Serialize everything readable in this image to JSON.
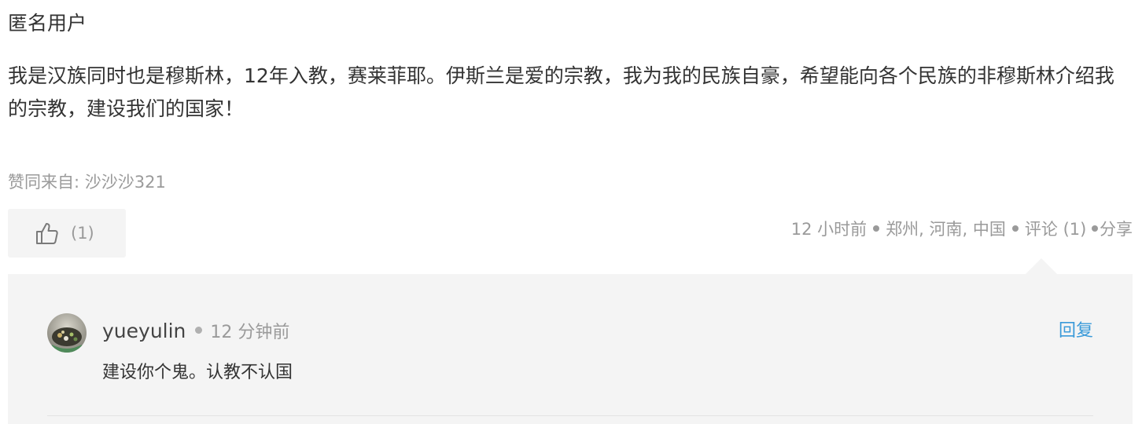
{
  "post": {
    "author": "匿名用户",
    "content": "我是汉族同时也是穆斯林，12年入教，赛莱菲耶。伊斯兰是爱的宗教，我为我的民族自豪，希望能向各个民族的非穆斯林介绍我的宗教，建设我们的国家！",
    "endorsed_by": "赞同来自: 沙沙沙321",
    "like_icon": "thumbs-up-icon",
    "like_count": "(1)",
    "meta": {
      "time": "12 小时前",
      "location": "郑州, 河南, 中国",
      "comments_label": "评论 (1)",
      "share_label": "分享"
    }
  },
  "comments": [
    {
      "user": "yueyulin",
      "time": "12 分钟前",
      "text": "建设你个鬼。认教不认国",
      "reply_label": "回复"
    }
  ],
  "colors": {
    "muted": "#9a9a9a",
    "link": "#3a9ad9",
    "panel": "#f4f4f4"
  }
}
